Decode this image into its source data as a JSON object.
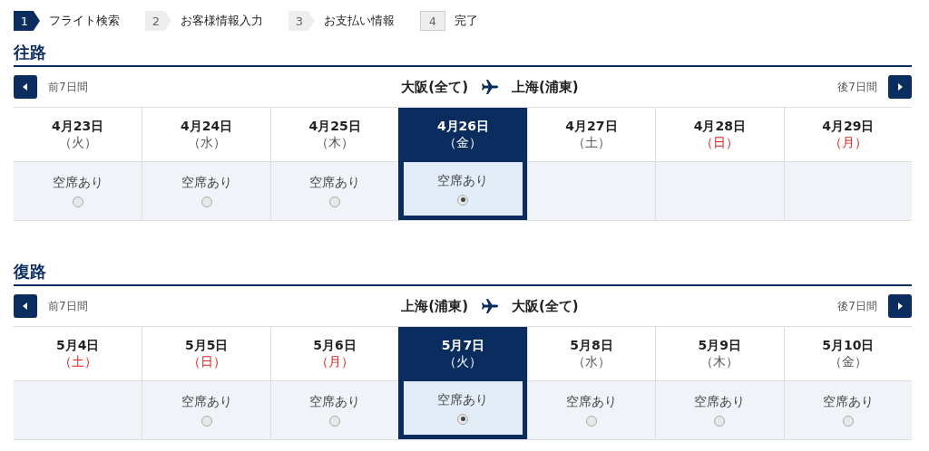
{
  "steps": [
    {
      "number": "1",
      "label": "フライト検索",
      "selected": true
    },
    {
      "number": "2",
      "label": "お客様情報入力",
      "selected": false
    },
    {
      "number": "3",
      "label": "お支払い情報",
      "selected": false
    },
    {
      "number": "4",
      "label": "完了",
      "selected": false
    }
  ],
  "sections": [
    {
      "title": "往路",
      "prev_label": "前7日間",
      "origin": "大阪(全て)",
      "destination": "上海(浦東)",
      "next_label": "後7日間",
      "days": [
        {
          "date": "4月23日",
          "weekday": "（火）",
          "holiday": false,
          "selected": false,
          "availability": "空席あり"
        },
        {
          "date": "4月24日",
          "weekday": "（水）",
          "holiday": false,
          "selected": false,
          "availability": "空席あり"
        },
        {
          "date": "4月25日",
          "weekday": "（木）",
          "holiday": false,
          "selected": false,
          "availability": "空席あり"
        },
        {
          "date": "4月26日",
          "weekday": "（金）",
          "holiday": false,
          "selected": true,
          "availability": "空席あり"
        },
        {
          "date": "4月27日",
          "weekday": "（土）",
          "holiday": false,
          "selected": false
        },
        {
          "date": "4月28日",
          "weekday": "（日）",
          "holiday": true,
          "selected": false
        },
        {
          "date": "4月29日",
          "weekday": "（月）",
          "holiday": true,
          "selected": false
        }
      ]
    },
    {
      "title": "復路",
      "prev_label": "前7日間",
      "origin": "上海(浦東)",
      "destination": "大阪(全て)",
      "next_label": "後7日間",
      "days": [
        {
          "date": "5月4日",
          "weekday": "（土）",
          "holiday": true,
          "selected": false
        },
        {
          "date": "5月5日",
          "weekday": "（日）",
          "holiday": true,
          "selected": false,
          "availability": "空席あり"
        },
        {
          "date": "5月6日",
          "weekday": "（月）",
          "holiday": true,
          "selected": false,
          "availability": "空席あり"
        },
        {
          "date": "5月7日",
          "weekday": "（火）",
          "holiday": false,
          "selected": true,
          "availability": "空席あり"
        },
        {
          "date": "5月8日",
          "weekday": "（水）",
          "holiday": false,
          "selected": false,
          "availability": "空席あり"
        },
        {
          "date": "5月9日",
          "weekday": "（木）",
          "holiday": false,
          "selected": false,
          "availability": "空席あり"
        },
        {
          "date": "5月10日",
          "weekday": "（金）",
          "holiday": false,
          "selected": false,
          "availability": "空席あり"
        }
      ]
    }
  ]
}
